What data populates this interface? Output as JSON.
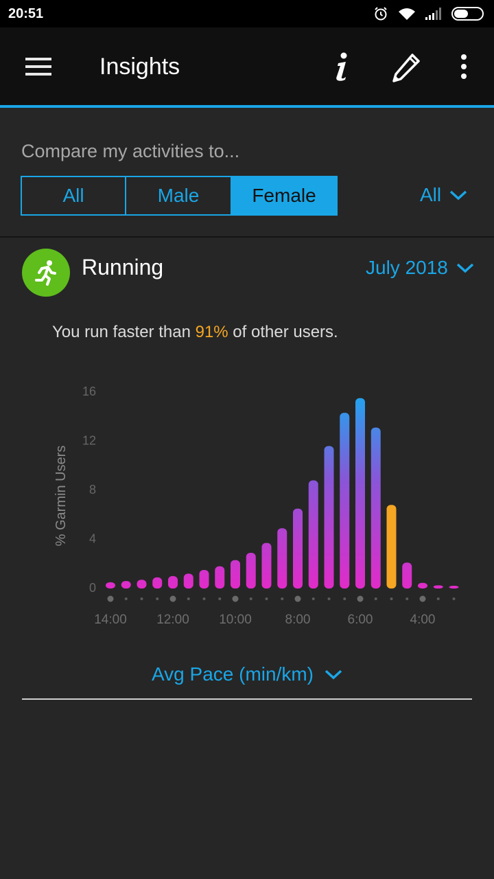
{
  "status": {
    "time": "20:51",
    "icons": [
      "alarm-icon",
      "wifi-icon",
      "signal-icon",
      "battery-icon"
    ]
  },
  "app_bar": {
    "title": "Insights",
    "actions": [
      "info-icon",
      "edit-icon",
      "more-vert-icon"
    ]
  },
  "compare": {
    "label": "Compare my activities to...",
    "segments": [
      "All",
      "Male",
      "Female"
    ],
    "selected": "Female",
    "filter_value": "All"
  },
  "activity": {
    "title": "Running",
    "icon": "running-icon",
    "period": "July 2018",
    "summary_pre": "You run faster than ",
    "summary_pct": "91%",
    "summary_post": " of other users.",
    "metric_label": "Avg Pace (min/km)"
  },
  "colors": {
    "accent": "#1aa6e6",
    "highlight": "#f5a623",
    "bar_low": "#e02cc8",
    "bar_high": "#1fa6ef",
    "running_green": "#5fbd1c"
  },
  "chart_data": {
    "type": "bar",
    "ylabel": "% Garmin Users",
    "yticks": [
      0,
      4,
      8,
      12,
      16
    ],
    "ylim": [
      0,
      16
    ],
    "xticks": [
      "14:00",
      "12:00",
      "10:00",
      "8:00",
      "6:00",
      "4:00"
    ],
    "x_range_pace_min": [
      14.0,
      3.0
    ],
    "bin_width_min": 0.5,
    "highlight_bin": 18,
    "values": [
      0.4,
      0.5,
      0.6,
      0.8,
      0.9,
      1.1,
      1.4,
      1.7,
      2.2,
      2.8,
      3.6,
      4.8,
      6.4,
      8.7,
      11.5,
      14.2,
      15.4,
      13.0,
      6.7,
      2.0,
      0.35,
      0.15,
      0.1
    ]
  }
}
